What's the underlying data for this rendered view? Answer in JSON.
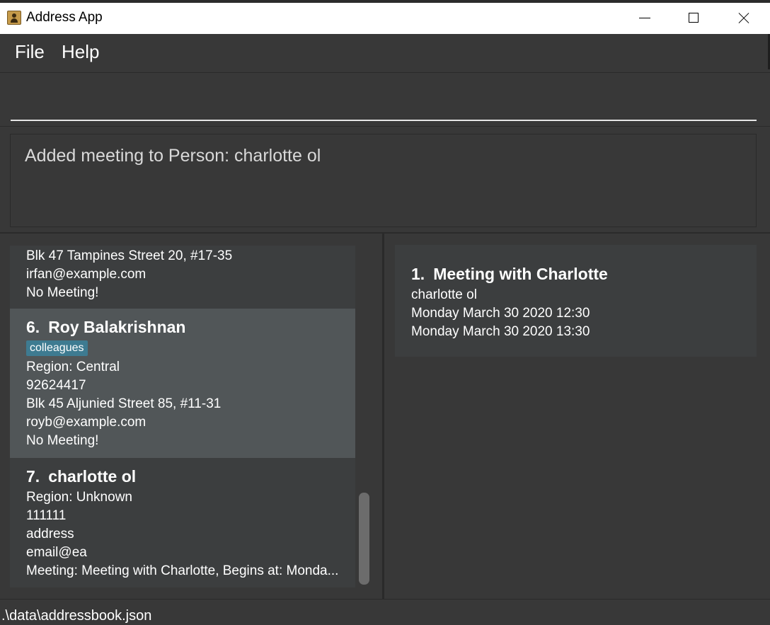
{
  "window": {
    "title": "Address App"
  },
  "menu": {
    "file": "File",
    "help": "Help"
  },
  "command": {
    "value": "",
    "placeholder": ""
  },
  "result": {
    "message": "Added meeting to Person: charlotte ol"
  },
  "persons": [
    {
      "address": "Blk 47 Tampines Street 20, #17-35",
      "email": "irfan@example.com",
      "meeting": "No Meeting!"
    },
    {
      "index": "6.",
      "name": "Roy Balakrishnan",
      "tag": "colleagues",
      "region": "Region: Central",
      "phone": "92624417",
      "address": "Blk 45 Aljunied Street 85, #11-31",
      "email": "royb@example.com",
      "meeting": "No Meeting!"
    },
    {
      "index": "7.",
      "name": "charlotte ol",
      "region": "Region: Unknown",
      "phone": "111111",
      "address": "address",
      "email": "email@ea",
      "meeting": "Meeting: Meeting with Charlotte, Begins at: Monda..."
    }
  ],
  "meetings": [
    {
      "index": "1.",
      "title": "Meeting with Charlotte",
      "person": "charlotte ol",
      "start": "Monday March 30 2020 12:30",
      "end": "Monday March 30 2020 13:30"
    }
  ],
  "status": {
    "file_path": ".\\data\\addressbook.json"
  },
  "colors": {
    "background": "#383838",
    "selected_card": "#515658",
    "card": "#3c3e3f",
    "tag": "#3e7b91"
  }
}
